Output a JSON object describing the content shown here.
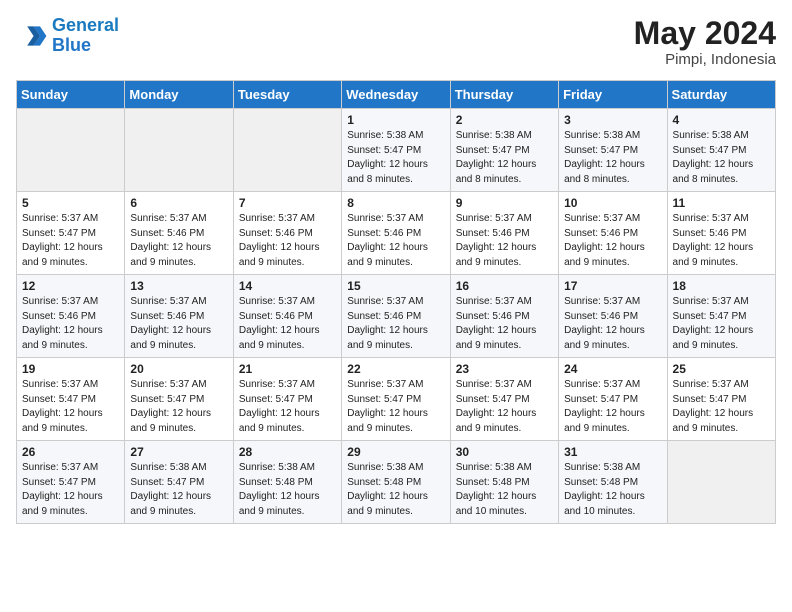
{
  "logo": {
    "line1": "General",
    "line2": "Blue"
  },
  "title": "May 2024",
  "location": "Pimpi, Indonesia",
  "weekdays": [
    "Sunday",
    "Monday",
    "Tuesday",
    "Wednesday",
    "Thursday",
    "Friday",
    "Saturday"
  ],
  "weeks": [
    [
      {
        "day": "",
        "info": ""
      },
      {
        "day": "",
        "info": ""
      },
      {
        "day": "",
        "info": ""
      },
      {
        "day": "1",
        "info": "Sunrise: 5:38 AM\nSunset: 5:47 PM\nDaylight: 12 hours\nand 8 minutes."
      },
      {
        "day": "2",
        "info": "Sunrise: 5:38 AM\nSunset: 5:47 PM\nDaylight: 12 hours\nand 8 minutes."
      },
      {
        "day": "3",
        "info": "Sunrise: 5:38 AM\nSunset: 5:47 PM\nDaylight: 12 hours\nand 8 minutes."
      },
      {
        "day": "4",
        "info": "Sunrise: 5:38 AM\nSunset: 5:47 PM\nDaylight: 12 hours\nand 8 minutes."
      }
    ],
    [
      {
        "day": "5",
        "info": "Sunrise: 5:37 AM\nSunset: 5:47 PM\nDaylight: 12 hours\nand 9 minutes."
      },
      {
        "day": "6",
        "info": "Sunrise: 5:37 AM\nSunset: 5:46 PM\nDaylight: 12 hours\nand 9 minutes."
      },
      {
        "day": "7",
        "info": "Sunrise: 5:37 AM\nSunset: 5:46 PM\nDaylight: 12 hours\nand 9 minutes."
      },
      {
        "day": "8",
        "info": "Sunrise: 5:37 AM\nSunset: 5:46 PM\nDaylight: 12 hours\nand 9 minutes."
      },
      {
        "day": "9",
        "info": "Sunrise: 5:37 AM\nSunset: 5:46 PM\nDaylight: 12 hours\nand 9 minutes."
      },
      {
        "day": "10",
        "info": "Sunrise: 5:37 AM\nSunset: 5:46 PM\nDaylight: 12 hours\nand 9 minutes."
      },
      {
        "day": "11",
        "info": "Sunrise: 5:37 AM\nSunset: 5:46 PM\nDaylight: 12 hours\nand 9 minutes."
      }
    ],
    [
      {
        "day": "12",
        "info": "Sunrise: 5:37 AM\nSunset: 5:46 PM\nDaylight: 12 hours\nand 9 minutes."
      },
      {
        "day": "13",
        "info": "Sunrise: 5:37 AM\nSunset: 5:46 PM\nDaylight: 12 hours\nand 9 minutes."
      },
      {
        "day": "14",
        "info": "Sunrise: 5:37 AM\nSunset: 5:46 PM\nDaylight: 12 hours\nand 9 minutes."
      },
      {
        "day": "15",
        "info": "Sunrise: 5:37 AM\nSunset: 5:46 PM\nDaylight: 12 hours\nand 9 minutes."
      },
      {
        "day": "16",
        "info": "Sunrise: 5:37 AM\nSunset: 5:46 PM\nDaylight: 12 hours\nand 9 minutes."
      },
      {
        "day": "17",
        "info": "Sunrise: 5:37 AM\nSunset: 5:46 PM\nDaylight: 12 hours\nand 9 minutes."
      },
      {
        "day": "18",
        "info": "Sunrise: 5:37 AM\nSunset: 5:47 PM\nDaylight: 12 hours\nand 9 minutes."
      }
    ],
    [
      {
        "day": "19",
        "info": "Sunrise: 5:37 AM\nSunset: 5:47 PM\nDaylight: 12 hours\nand 9 minutes."
      },
      {
        "day": "20",
        "info": "Sunrise: 5:37 AM\nSunset: 5:47 PM\nDaylight: 12 hours\nand 9 minutes."
      },
      {
        "day": "21",
        "info": "Sunrise: 5:37 AM\nSunset: 5:47 PM\nDaylight: 12 hours\nand 9 minutes."
      },
      {
        "day": "22",
        "info": "Sunrise: 5:37 AM\nSunset: 5:47 PM\nDaylight: 12 hours\nand 9 minutes."
      },
      {
        "day": "23",
        "info": "Sunrise: 5:37 AM\nSunset: 5:47 PM\nDaylight: 12 hours\nand 9 minutes."
      },
      {
        "day": "24",
        "info": "Sunrise: 5:37 AM\nSunset: 5:47 PM\nDaylight: 12 hours\nand 9 minutes."
      },
      {
        "day": "25",
        "info": "Sunrise: 5:37 AM\nSunset: 5:47 PM\nDaylight: 12 hours\nand 9 minutes."
      }
    ],
    [
      {
        "day": "26",
        "info": "Sunrise: 5:37 AM\nSunset: 5:47 PM\nDaylight: 12 hours\nand 9 minutes."
      },
      {
        "day": "27",
        "info": "Sunrise: 5:38 AM\nSunset: 5:47 PM\nDaylight: 12 hours\nand 9 minutes."
      },
      {
        "day": "28",
        "info": "Sunrise: 5:38 AM\nSunset: 5:48 PM\nDaylight: 12 hours\nand 9 minutes."
      },
      {
        "day": "29",
        "info": "Sunrise: 5:38 AM\nSunset: 5:48 PM\nDaylight: 12 hours\nand 9 minutes."
      },
      {
        "day": "30",
        "info": "Sunrise: 5:38 AM\nSunset: 5:48 PM\nDaylight: 12 hours\nand 10 minutes."
      },
      {
        "day": "31",
        "info": "Sunrise: 5:38 AM\nSunset: 5:48 PM\nDaylight: 12 hours\nand 10 minutes."
      },
      {
        "day": "",
        "info": ""
      }
    ]
  ]
}
